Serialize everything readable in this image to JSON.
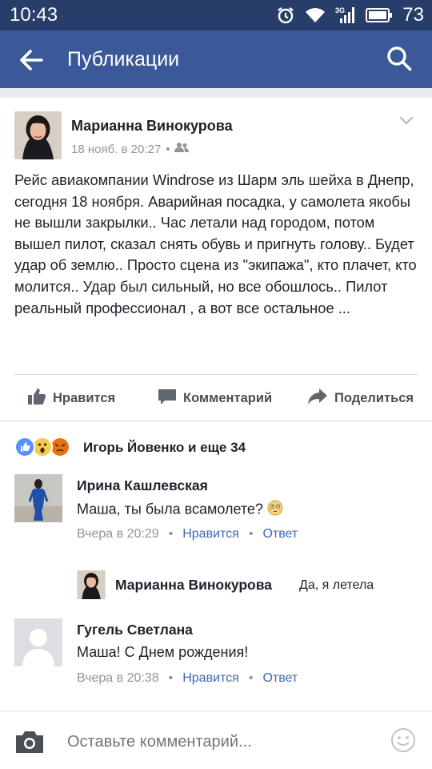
{
  "status_bar": {
    "time": "10:43",
    "network": "3G",
    "battery": "73",
    "icons": [
      "alarm-icon",
      "wifi-icon",
      "signal-icon",
      "battery-icon"
    ]
  },
  "app_bar": {
    "title": "Публикации",
    "back_icon": "arrow-left-icon",
    "search_icon": "search-icon"
  },
  "post": {
    "author": "Марианна Винокурова",
    "timestamp": "18 нояб. в 20:27",
    "audience_icon": "friends-icon",
    "text": "Рейс авиакомпании Windrose из Шарм  эль шейха в Днепр, сегодня 18 ноября. Аварийная посадка, у самолета якобы не вышли закрылки.. Час летали над городом, потом вышел пилот, сказал снять обувь и пригнуть голову.. Будет удар об землю.. Просто сцена из \"экипажа\", кто плачет, кто молится.. Удар был сильный, но все обошлось.. Пилот реальный профессионал , а вот все остальное ..."
  },
  "actions": {
    "like": "Нравится",
    "comment": "Комментарий",
    "share": "Поделиться"
  },
  "reactions": {
    "names": "Игорь Йовенко и еще 34",
    "types": [
      "like",
      "wow",
      "angry"
    ]
  },
  "comments": [
    {
      "name": "Ирина Кашлевская",
      "text": "Маша, ты была всамолете?",
      "time": "Вчера в 20:29",
      "like": "Нравится",
      "reply": "Ответ"
    },
    {
      "name": "Гугель Светлана",
      "text": "Маша! С Днем рождения!",
      "time": "Вчера в 20:38",
      "like": "Нравится",
      "reply": "Ответ"
    }
  ],
  "reply": {
    "name": "Марианна Винокурова",
    "text": "Да, я летела"
  },
  "composer": {
    "placeholder": "Оставьте комментарий..."
  },
  "colors": {
    "status_bar": "#283e6a",
    "app_bar": "#3b5998",
    "link": "#4267b2",
    "muted": "#90949c"
  }
}
